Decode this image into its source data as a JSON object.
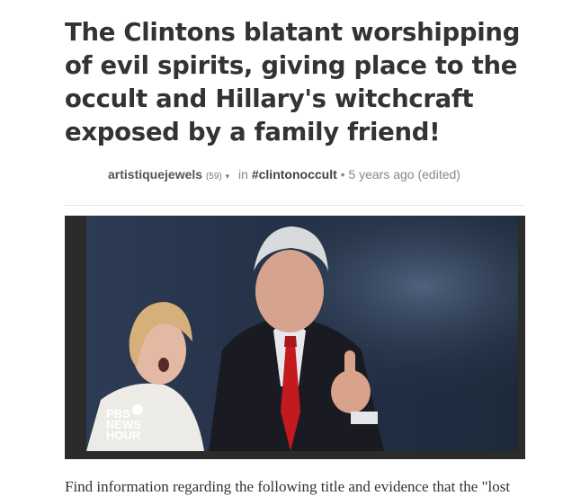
{
  "post": {
    "title": "The Clintons blatant worshipping of evil spirits, giving place to the occult and Hillary's witchcraft exposed by a family friend!",
    "author": "artistiquejewels",
    "reputation": "(59)",
    "in_label": "in",
    "tag": "#clintonoccult",
    "timestamp": "5 years ago (edited)",
    "caret_icon": "chevron-down-icon",
    "image": {
      "logo_line1": "PBS",
      "logo_line2": "NEWS",
      "logo_line3": "HOUR"
    },
    "body_first_line": "Find information regarding the following title and evidence that the \"lost"
  }
}
